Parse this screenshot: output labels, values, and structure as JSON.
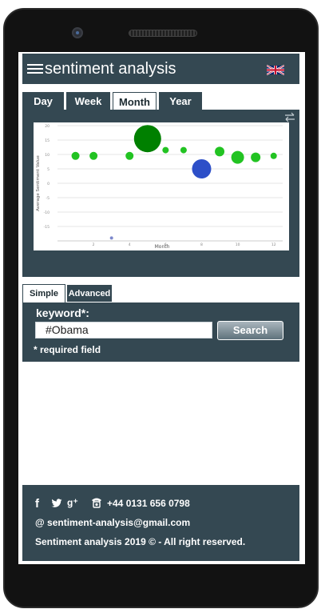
{
  "header": {
    "title": "sentiment analysis",
    "flag_icon": "uk-flag-icon",
    "menu_icon": "hamburger-menu-icon"
  },
  "period_tabs": [
    {
      "label": "Day",
      "active": false
    },
    {
      "label": "Week",
      "active": false
    },
    {
      "label": "Month",
      "active": true
    },
    {
      "label": "Year",
      "active": false
    }
  ],
  "chart_data": {
    "type": "scatter",
    "title": "",
    "xlabel": "Month",
    "ylabel": "Average Sentiment Value",
    "xlim": [
      0,
      12.5
    ],
    "ylim": [
      -20,
      20
    ],
    "x_ticks": [
      "2",
      "4",
      "6",
      "8",
      "10",
      "12"
    ],
    "y_ticks": [
      "20",
      "15",
      "10",
      "5",
      "0",
      "-5",
      "-10",
      "-15"
    ],
    "grid": true,
    "points": [
      {
        "x": 1,
        "y": 9.5,
        "size": 5,
        "color": "#22c322"
      },
      {
        "x": 2,
        "y": 9.5,
        "size": 5,
        "color": "#22c322"
      },
      {
        "x": 3,
        "y": -19,
        "size": 2,
        "color": "#7d88cc"
      },
      {
        "x": 4,
        "y": 9.5,
        "size": 5,
        "color": "#22c322"
      },
      {
        "x": 5,
        "y": 15.5,
        "size": 17,
        "color": "#008000"
      },
      {
        "x": 6,
        "y": 11.5,
        "size": 4,
        "color": "#22c322"
      },
      {
        "x": 7,
        "y": 11.5,
        "size": 4,
        "color": "#22c322"
      },
      {
        "x": 8,
        "y": 5,
        "size": 12,
        "color": "#2d4fc8"
      },
      {
        "x": 9,
        "y": 11,
        "size": 6,
        "color": "#22c322"
      },
      {
        "x": 10,
        "y": 9,
        "size": 8,
        "color": "#22c322"
      },
      {
        "x": 11,
        "y": 9,
        "size": 6,
        "color": "#22c322"
      },
      {
        "x": 12,
        "y": 9.5,
        "size": 4,
        "color": "#22c322"
      }
    ]
  },
  "search_tabs": [
    {
      "label": "Simple",
      "active": true
    },
    {
      "label": "Advanced",
      "active": false
    }
  ],
  "search": {
    "keyword_label": "keyword*:",
    "value": "#Obama",
    "button_label": "Search",
    "required_note": "* required field"
  },
  "footer": {
    "phone": "+44 0131 656 0798",
    "email": "@ sentiment-analysis@gmail.com",
    "copyright": "Sentiment analysis 2019 © - All right reserved.",
    "social_icons": [
      "facebook-icon",
      "twitter-icon",
      "google-plus-icon"
    ]
  },
  "colors": {
    "panel": "#344852",
    "accent_green": "#22c322",
    "dark_green": "#008000",
    "blue": "#2d4fc8"
  }
}
